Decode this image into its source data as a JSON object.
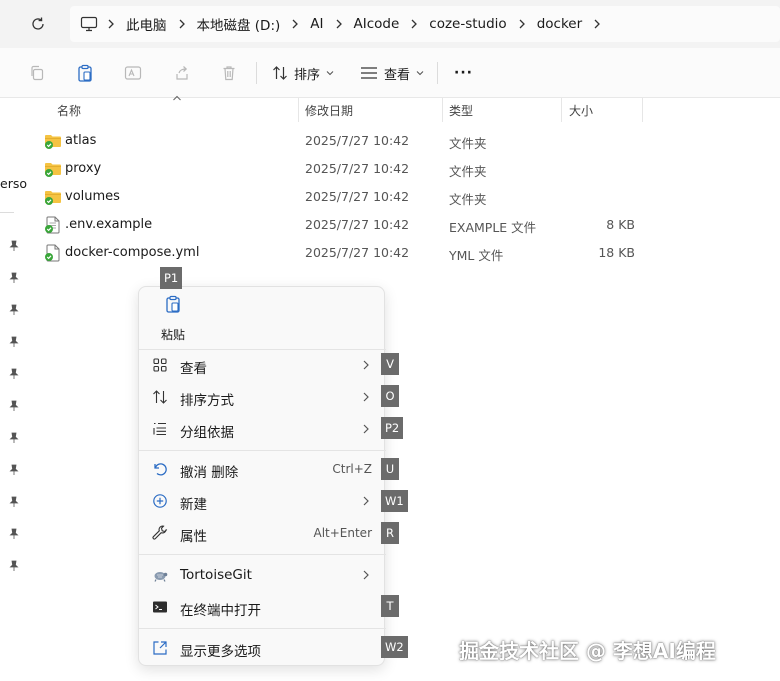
{
  "breadcrumb": [
    "此电脑",
    "本地磁盘 (D:)",
    "AI",
    "AIcode",
    "coze-studio",
    "docker"
  ],
  "toolbar": {
    "sort_label": "排序",
    "view_label": "查看",
    "more_label": "···"
  },
  "nav": {
    "partial_label": "erso"
  },
  "columns": {
    "name": "名称",
    "date": "修改日期",
    "type": "类型",
    "size": "大小"
  },
  "files": [
    {
      "name": "atlas",
      "date": "2025/7/27 10:42",
      "type": "文件夹",
      "size": ""
    },
    {
      "name": "proxy",
      "date": "2025/7/27 10:42",
      "type": "文件夹",
      "size": ""
    },
    {
      "name": "volumes",
      "date": "2025/7/27 10:42",
      "type": "文件夹",
      "size": ""
    },
    {
      "name": ".env.example",
      "date": "2025/7/27 10:42",
      "type": "EXAMPLE 文件",
      "size": "8 KB"
    },
    {
      "name": "docker-compose.yml",
      "date": "2025/7/27 10:42",
      "type": "YML 文件",
      "size": "18 KB"
    }
  ],
  "menu": {
    "paste_label": "粘贴",
    "items": [
      {
        "label": "查看",
        "shortcut": ""
      },
      {
        "label": "排序方式",
        "shortcut": ""
      },
      {
        "label": "分组依据",
        "shortcut": ""
      },
      {
        "label": "撤消 删除",
        "shortcut": "Ctrl+Z"
      },
      {
        "label": "新建",
        "shortcut": ""
      },
      {
        "label": "属性",
        "shortcut": "Alt+Enter"
      },
      {
        "label": "TortoiseGit",
        "shortcut": ""
      },
      {
        "label": "在终端中打开",
        "shortcut": ""
      },
      {
        "label": "显示更多选项",
        "shortcut": ""
      }
    ]
  },
  "keytips": [
    "P1",
    "V",
    "O",
    "P2",
    "U",
    "W1",
    "R",
    "T",
    "W2"
  ],
  "watermark": "掘金技术社区 @ 李想AI编程",
  "colors": {
    "folder": "#f5c342",
    "badge": "#3aa63a",
    "keytip": "#6b6b6b",
    "accent": "#2b6cc4"
  }
}
